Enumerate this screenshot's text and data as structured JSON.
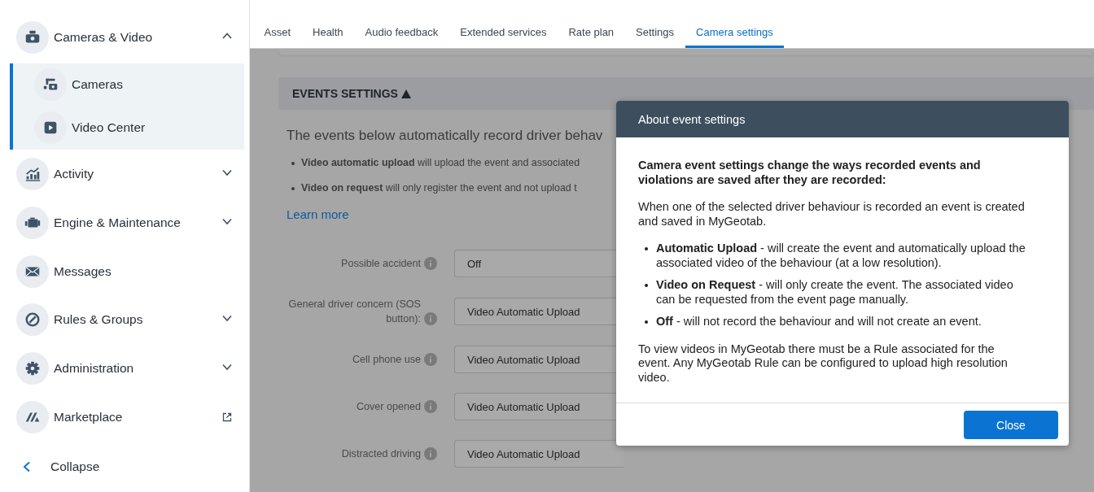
{
  "sidebar": {
    "items": [
      {
        "label": "Cameras & Video",
        "kind": "group",
        "expanded": true,
        "children": [
          {
            "label": "Cameras"
          },
          {
            "label": "Video Center"
          }
        ]
      },
      {
        "label": "Activity",
        "kind": "group",
        "expanded": false
      },
      {
        "label": "Engine & Maintenance",
        "kind": "group",
        "expanded": false
      },
      {
        "label": "Messages",
        "kind": "link"
      },
      {
        "label": "Rules & Groups",
        "kind": "group",
        "expanded": false
      },
      {
        "label": "Administration",
        "kind": "group",
        "expanded": false
      },
      {
        "label": "Marketplace",
        "kind": "external"
      }
    ],
    "collapse": {
      "label": "Collapse"
    }
  },
  "tabs": [
    {
      "label": "Asset",
      "selected": false
    },
    {
      "label": "Health",
      "selected": false
    },
    {
      "label": "Audio feedback",
      "selected": false
    },
    {
      "label": "Extended services",
      "selected": false
    },
    {
      "label": "Rate plan",
      "selected": false
    },
    {
      "label": "Settings",
      "selected": false
    },
    {
      "label": "Camera settings",
      "selected": true
    }
  ],
  "events_settings": {
    "title": "EVENTS SETTINGS",
    "expanded": true,
    "intro": "The events below automatically record driver behav",
    "bullets": [
      "**Video automatic upload** will upload the event and associated",
      "**Video on request** will only register the event and not upload t"
    ],
    "link": "Learn more",
    "settings": [
      {
        "label": "Possible accident",
        "value": "Off"
      },
      {
        "label": "General driver concern (SOS button):",
        "value": "Video Automatic Upload"
      },
      {
        "label": "Cell phone use",
        "value": "Video Automatic Upload"
      },
      {
        "label": "Cover opened",
        "value": "Video Automatic Upload"
      },
      {
        "label": "Distracted driving",
        "value": "Video Automatic Upload"
      }
    ]
  },
  "dialog": {
    "title": "About event settings",
    "lead": "Camera event settings change the ways recorded events and violations are saved after they are recorded:",
    "paragraph": "When one of the selected driver behaviour is recorded an event is created and saved in MyGeotab.",
    "bullets": [
      "**Automatic Upload** - will create the event and automatically upload the associated video of the behaviour (at a low resolution).",
      "**Video on Request** - will only create the event. The associated video can be requested from the event page manually.",
      "**Off** - will not record the behaviour and will not create an event."
    ],
    "note": "To view videos in MyGeotab there must be a Rule associated for the event. Any MyGeotab Rule can be configured to upload high resolution video.",
    "button": "Close"
  }
}
